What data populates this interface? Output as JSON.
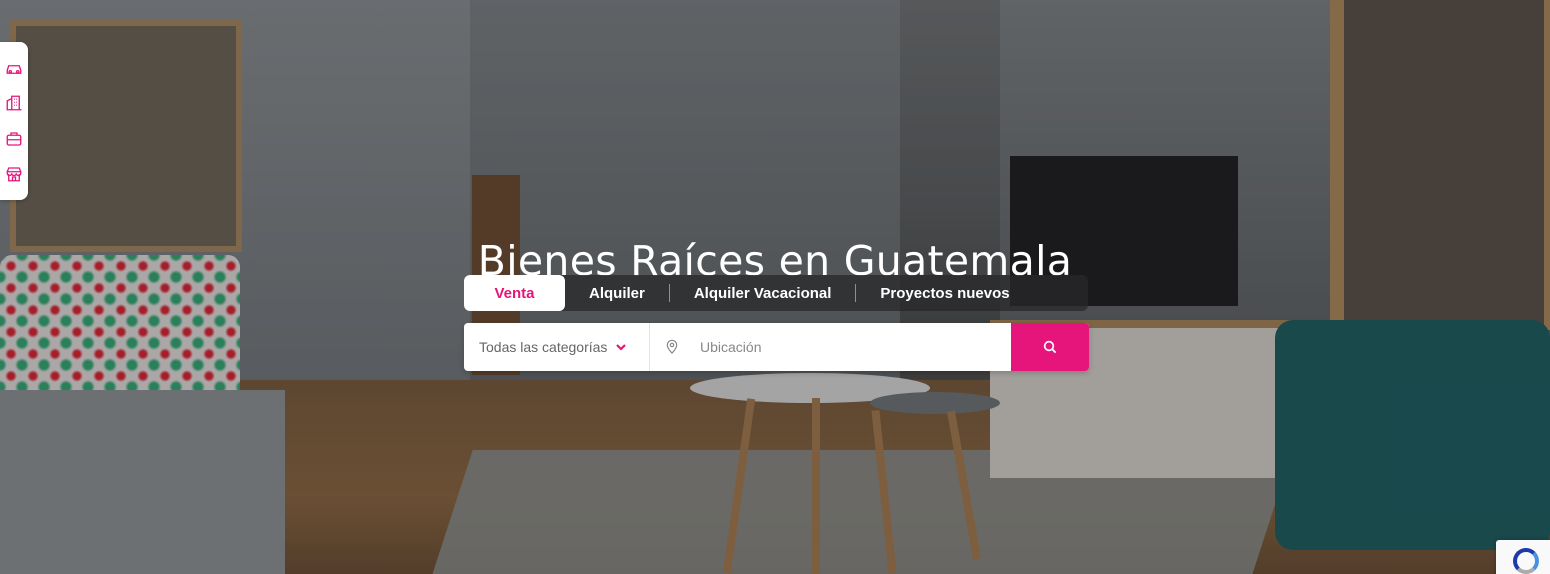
{
  "sidebar": {
    "icons": [
      "car-icon",
      "building-icon",
      "briefcase-icon",
      "store-icon"
    ],
    "accent": "#e5157c"
  },
  "hero": {
    "title": "Bienes Raíces en Guatemala"
  },
  "tabs": [
    {
      "label": "Venta",
      "active": true
    },
    {
      "label": "Alquiler",
      "active": false
    },
    {
      "label": "Alquiler Vacacional",
      "active": false
    },
    {
      "label": "Proyectos nuevos",
      "active": false
    }
  ],
  "search": {
    "category_value": "Todas las categorías",
    "location_placeholder": "Ubicación",
    "button_icon": "search-icon",
    "accent": "#e5157c"
  },
  "recaptcha": {
    "icon": "recaptcha-icon"
  }
}
